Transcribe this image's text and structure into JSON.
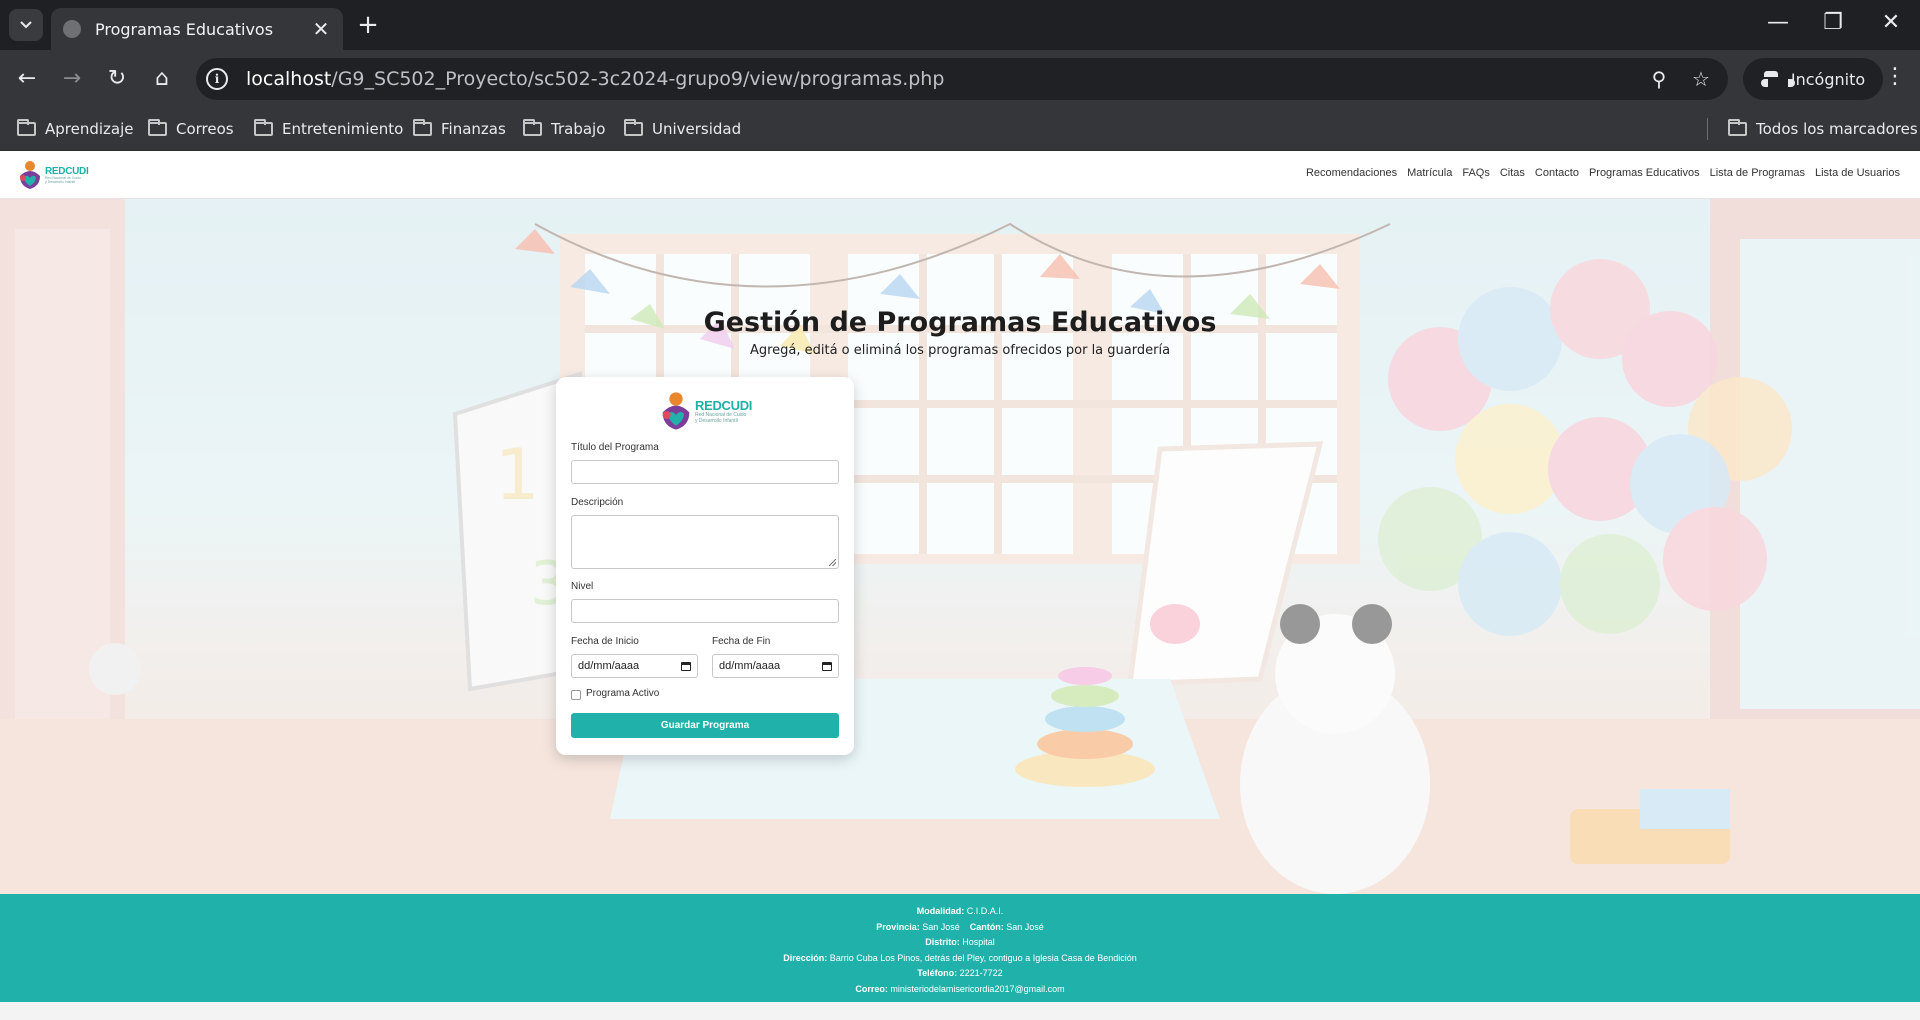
{
  "browser": {
    "tab_title": "Programas Educativos",
    "new_tab": "+",
    "url_host": "localhost",
    "url_path": "/G9_SC502_Proyecto/sc502-3c2024-grupo9/view/programas.php",
    "incognito_label": "Incógnito",
    "icons": {
      "tab_search": "chevron-down-icon",
      "favicon": "globe-icon",
      "close": "close-icon",
      "back": "back-arrow-icon",
      "forward": "forward-arrow-icon",
      "reload": "reload-icon",
      "home": "home-icon",
      "site_info": "info-icon",
      "zoom": "zoom-icon",
      "bookmark_star": "star-icon",
      "menu": "kebab-menu-icon",
      "minimize": "minimize-icon",
      "restore": "restore-icon",
      "window_close": "close-icon"
    },
    "bookmarks": [
      "Aprendizaje",
      "Correos",
      "Entretenimiento",
      "Finanzas",
      "Trabajo",
      "Universidad"
    ],
    "all_bookmarks": "Todos los marcadores"
  },
  "site": {
    "logo_main": "REDCUDI",
    "logo_sub_1": "Red Nacional de Cuido",
    "logo_sub_2": "y Desarrollo Infantil",
    "nav": [
      "Recomendaciones",
      "Matrícula",
      "FAQs",
      "Citas",
      "Contacto",
      "Programas Educativos",
      "Lista de Programas",
      "Lista de Usuarios"
    ],
    "title": "Gestión de Programas Educativos",
    "subtitle": "Agregá, editá o eliminá los programas ofrecidos por la guardería",
    "accent_color": "#20b2aa"
  },
  "form": {
    "titulo_label": "Título del Programa",
    "titulo_value": "",
    "descripcion_label": "Descripción",
    "descripcion_value": "",
    "nivel_label": "Nivel",
    "nivel_value": "",
    "fecha_inicio_label": "Fecha de Inicio",
    "fecha_inicio_value": "dd/mm/aaaa",
    "fecha_fin_label": "Fecha de Fin",
    "fecha_fin_value": "dd/mm/aaaa",
    "activo_label": "Programa Activo",
    "activo_checked": false,
    "submit_label": "Guardar Programa"
  },
  "footer": {
    "modalidad_label": "Modalidad:",
    "modalidad_value": "C.I.D.A.I.",
    "provincia_label": "Provincia:",
    "provincia_value": "San José",
    "canton_label": "Cantón:",
    "canton_value": "San José",
    "distrito_label": "Distrito:",
    "distrito_value": "Hospital",
    "direccion_label": "Dirección:",
    "direccion_value": "Barrio Cuba Los Pinos, detrás del Pley, contiguo a Iglesia Casa de Bendición",
    "telefono_label": "Teléfono:",
    "telefono_value": "2221-7722",
    "correo_label": "Correo:",
    "correo_value": "ministeriodelamisericordia2017@gmail.com"
  }
}
